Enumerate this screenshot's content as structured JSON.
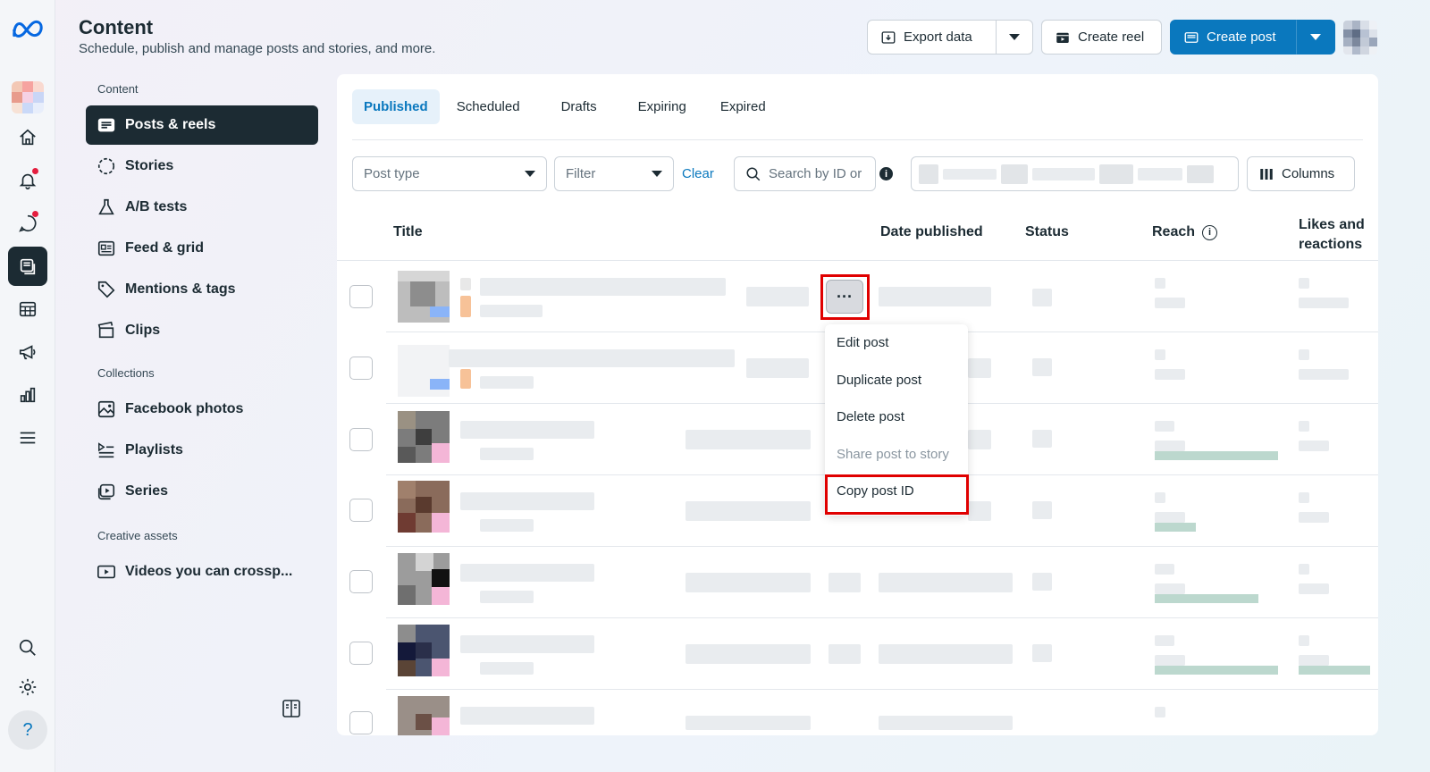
{
  "header": {
    "title": "Content",
    "subtitle": "Schedule, publish and manage posts and stories, and more.",
    "export_label": "Export data",
    "create_reel_label": "Create reel",
    "create_post_label": "Create post"
  },
  "left_nav": {
    "section_content": "Content",
    "items_content": [
      {
        "label": "Posts & reels",
        "icon": "posts-icon"
      },
      {
        "label": "Stories",
        "icon": "stories-icon"
      },
      {
        "label": "A/B tests",
        "icon": "flask-icon"
      },
      {
        "label": "Feed & grid",
        "icon": "grid-icon"
      },
      {
        "label": "Mentions & tags",
        "icon": "tag-icon"
      },
      {
        "label": "Clips",
        "icon": "clapper-icon"
      }
    ],
    "section_collections": "Collections",
    "items_collections": [
      {
        "label": "Facebook photos",
        "icon": "photo-icon"
      },
      {
        "label": "Playlists",
        "icon": "playlist-icon"
      },
      {
        "label": "Series",
        "icon": "series-icon"
      }
    ],
    "section_creative": "Creative assets",
    "items_creative": [
      {
        "label": "Videos you can crossp...",
        "icon": "video-icon"
      }
    ]
  },
  "tabs": [
    "Published",
    "Scheduled",
    "Drafts",
    "Expiring",
    "Expired"
  ],
  "filters": {
    "post_type_placeholder": "Post type",
    "filter_placeholder": "Filter",
    "clear_label": "Clear",
    "search_placeholder": "Search by ID or",
    "columns_label": "Columns"
  },
  "table": {
    "headers": {
      "title": "Title",
      "date": "Date published",
      "status": "Status",
      "reach": "Reach",
      "likes_line1": "Likes and",
      "likes_line2": "reactions"
    }
  },
  "context_menu": {
    "more_label": "···",
    "items": [
      "Edit post",
      "Duplicate post",
      "Delete post",
      "Share post to story",
      "Copy post ID"
    ]
  }
}
